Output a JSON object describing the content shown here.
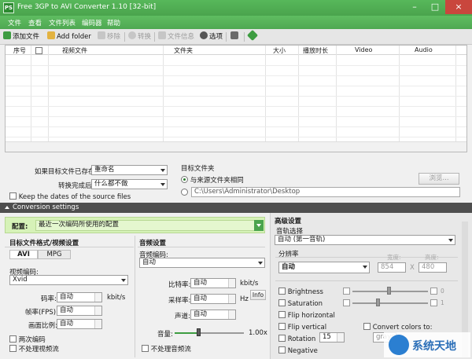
{
  "window": {
    "title": "Free 3GP to AVI Converter 1.10  [32-bit]",
    "app_icon_text": "PS",
    "minimize": "–",
    "maximize": "□",
    "close": "×"
  },
  "menu": [
    "文件",
    "查看",
    "文件列表",
    "编码器",
    "帮助"
  ],
  "toolbar": {
    "add_file": "添加文件",
    "add_folder": "Add folder",
    "remove": "移除",
    "convert": "转换",
    "file_info": "文件信息",
    "options": "选项"
  },
  "file_list": {
    "columns": [
      "序号",
      "视频文件",
      "文件夹",
      "大小",
      "播放时长",
      "Video",
      "Audio"
    ]
  },
  "output": {
    "if_exists_label": "如果目标文件已存在:",
    "if_exists_value": "重命名",
    "after_convert_label": "转换完成后:",
    "after_convert_value": "什么都不做",
    "keep_dates_label": "Keep the dates of the source files",
    "target_folder_title": "目标文件夹",
    "same_as_source": "与来源文件夹相同",
    "custom_path": "C:\\Users\\Administrator\\Desktop",
    "browse": "浏览..."
  },
  "conversion": {
    "header": "Conversion settings",
    "profile_label": "配置:",
    "profile_value": "最近一次编码所使用的配置"
  },
  "video": {
    "title": "目标文件格式/视频设置",
    "tabs": [
      "AVI",
      "MPG"
    ],
    "codec_label": "视频编码:",
    "codec_value": "Xvid",
    "bitrate_label": "码率:",
    "bitrate_value": "自动",
    "bitrate_unit": "kbit/s",
    "fps_label": "帧率(FPS):",
    "fps_value": "自动",
    "aspect_label": "画面比例:",
    "aspect_value": "自动",
    "two_pass": "两次编码",
    "no_video": "不处理视频流"
  },
  "audio": {
    "title": "音频设置",
    "codec_label": "音频编码:",
    "codec_value": "自动",
    "bitrate_label": "比特率:",
    "bitrate_value": "自动",
    "bitrate_unit": "kbit/s",
    "samplerate_label": "采样率:",
    "samplerate_value": "自动",
    "samplerate_unit": "Hz",
    "info": "Info",
    "channels_label": "声道:",
    "channels_value": "自动",
    "volume_label": "音量:",
    "volume_value": "1.00x",
    "volume_level": 0.45,
    "no_audio": "不处理音频流"
  },
  "advanced": {
    "title": "高级设置",
    "track_label": "音轨选择",
    "track_value": "自动 (第一音轨)",
    "resolution_label": "分辨率",
    "resolution_value": "自动",
    "width_label": "宽度:",
    "height_label": "高度:",
    "width_value": "854",
    "height_value": "480",
    "x_sep": "X",
    "brightness": "Brightness",
    "brightness_value": "0",
    "saturation": "Saturation",
    "saturation_value": "1",
    "flip_h": "Flip horizontal",
    "flip_v": "Flip vertical",
    "convert_colors": "Convert colors to:",
    "convert_colors_value": "grays",
    "rotation": "Rotation",
    "rotation_value": "15",
    "negative": "Negative"
  },
  "watermark": "系统天地"
}
